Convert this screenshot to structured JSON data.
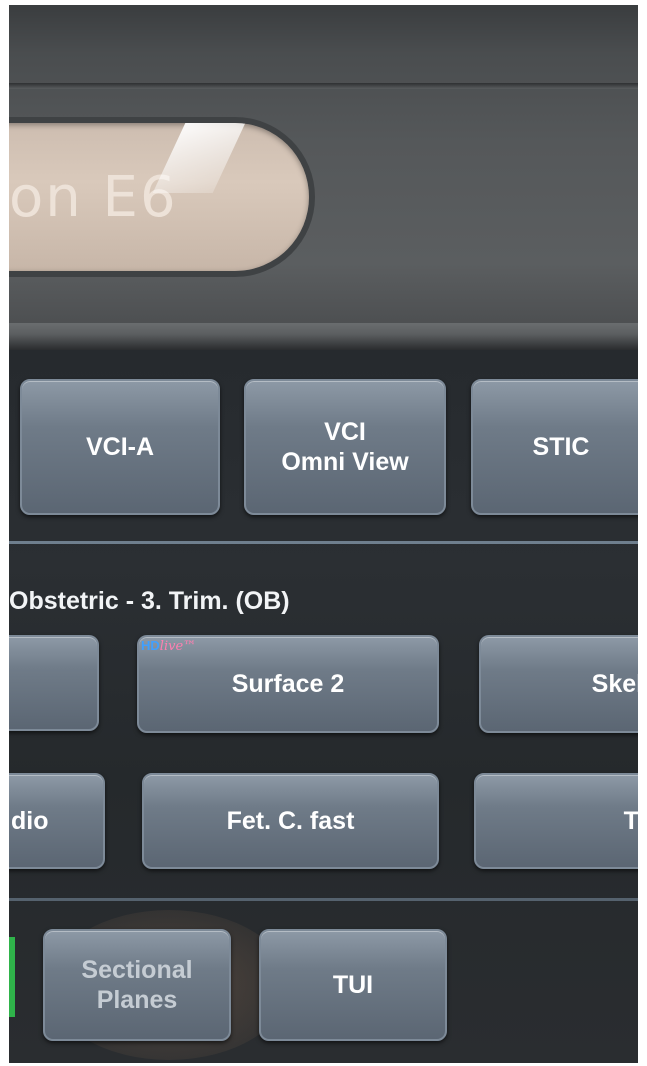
{
  "device": {
    "logo_text": "on E6"
  },
  "screen": {
    "top_row": {
      "buttons": [
        {
          "label": "VCI-A"
        },
        {
          "label": "VCI\nOmni View"
        },
        {
          "label": "STIC"
        }
      ]
    },
    "protocol_title": "Obstetric - 3. Trim. (OB)",
    "row2": {
      "buttons": [
        {
          "label": ""
        },
        {
          "label": "Surface 2",
          "badge_hd": "HD",
          "badge_live": "live™"
        },
        {
          "label": "Skele"
        }
      ]
    },
    "row3": {
      "buttons": [
        {
          "label": "dio"
        },
        {
          "label": "Fet. C. fast"
        },
        {
          "label": "TU"
        }
      ]
    },
    "bottom_row": {
      "buttons": [
        {
          "label": "Sectional\nPlanes"
        },
        {
          "label": "TUI"
        }
      ]
    }
  }
}
